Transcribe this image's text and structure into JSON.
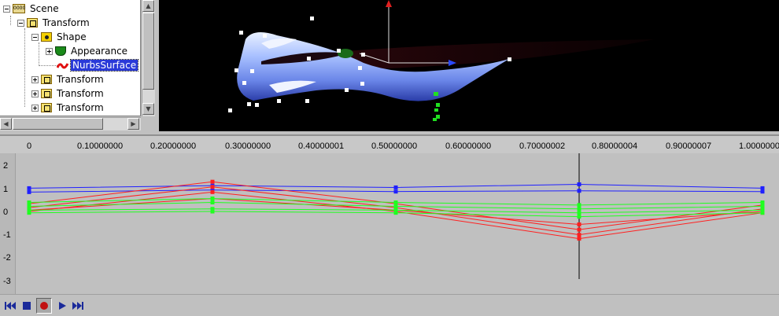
{
  "tree": {
    "nodes": [
      {
        "label": "Scene",
        "icon": "scene-icon"
      },
      {
        "label": "Transform",
        "icon": "transform-icon"
      },
      {
        "label": "Shape",
        "icon": "shape-icon"
      },
      {
        "label": "Appearance",
        "icon": "appearance-icon"
      },
      {
        "label": "NurbsSurface",
        "icon": "nurbs-surface-icon",
        "selected": true
      },
      {
        "label": "Transform",
        "icon": "transform-icon"
      },
      {
        "label": "Transform",
        "icon": "transform-icon"
      },
      {
        "label": "Transform",
        "icon": "transform-icon"
      }
    ]
  },
  "timeline": {
    "ticks": [
      "0",
      "0.10000000",
      "0.20000000",
      "0.30000000",
      "0.40000001",
      "0.50000000",
      "0.60000000",
      "0.70000002",
      "0.80000004",
      "0.90000007",
      "1.0000000"
    ],
    "y_ticks": [
      "2",
      "1",
      "0",
      "-1",
      "-2",
      "-3"
    ],
    "current_time": 0.75
  },
  "chart_data": {
    "type": "line",
    "x": [
      0,
      0.25,
      0.5,
      0.75,
      1.0
    ],
    "ylim": [
      -3.3,
      2.2
    ],
    "series": [
      {
        "color": "#2020ff",
        "values": [
          0.85,
          0.95,
          0.88,
          1.0,
          0.85
        ]
      },
      {
        "color": "#2020ff",
        "values": [
          0.7,
          0.78,
          0.72,
          0.75,
          0.72
        ]
      },
      {
        "color": "#ff2020",
        "values": [
          0.25,
          1.1,
          0.25,
          -0.75,
          0.2
        ]
      },
      {
        "color": "#ff2020",
        "values": [
          0.1,
          0.9,
          0.1,
          -0.95,
          0.05
        ]
      },
      {
        "color": "#ff2020",
        "values": [
          -0.05,
          0.7,
          -0.05,
          -1.1,
          -0.1
        ]
      },
      {
        "color": "#ff2020",
        "values": [
          0.0,
          0.45,
          0.0,
          -0.55,
          -0.05
        ]
      },
      {
        "color": "#20ff20",
        "values": [
          0.3,
          0.45,
          0.3,
          0.2,
          0.3
        ]
      },
      {
        "color": "#20ff20",
        "values": [
          0.15,
          0.3,
          0.15,
          0.05,
          0.15
        ]
      },
      {
        "color": "#20ff20",
        "values": [
          0.0,
          0.05,
          0.0,
          -0.1,
          0.0
        ]
      },
      {
        "color": "#20ff20",
        "values": [
          -0.1,
          -0.05,
          -0.1,
          -0.25,
          -0.1
        ]
      }
    ]
  },
  "transport": {
    "buttons": [
      "rewind-icon",
      "stop-icon",
      "record-icon",
      "play-icon",
      "fast-forward-icon"
    ]
  }
}
